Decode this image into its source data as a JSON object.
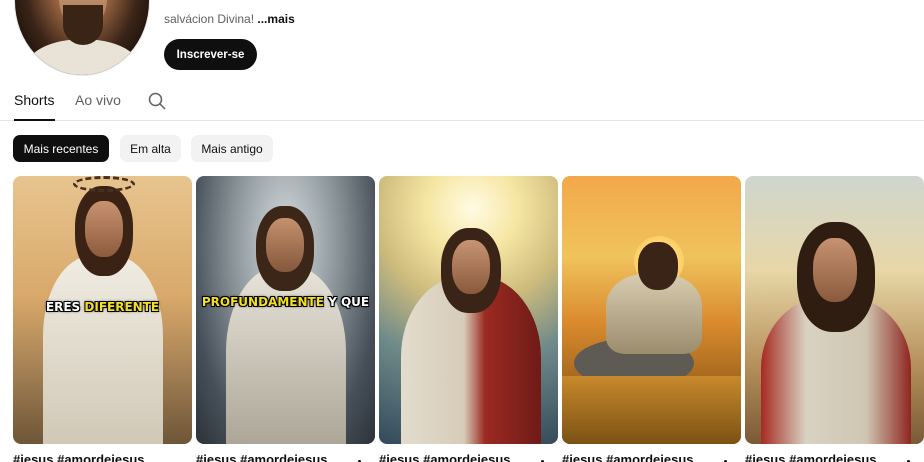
{
  "channel": {
    "description": "salvácion Divina!",
    "more_label": "...mais",
    "subscribe_label": "Inscrever-se"
  },
  "tabs": [
    {
      "label": "Shorts",
      "active": true
    },
    {
      "label": "Ao vivo",
      "active": false
    }
  ],
  "filters": [
    {
      "label": "Mais recentes",
      "active": true
    },
    {
      "label": "Em alta",
      "active": false
    },
    {
      "label": "Mais antigo",
      "active": false
    }
  ],
  "shorts": [
    {
      "title": "#jesus #amordejesus",
      "overlay_plain": "ERES ",
      "overlay_highlight": "DIFERENTE"
    },
    {
      "title": "#jesus #amordejesus",
      "overlay_highlight": "PROFUNDAMENTE",
      "overlay_plain": " Y QUE"
    },
    {
      "title": "#jesus #amordejesus"
    },
    {
      "title": "#jesus #amordejesus"
    },
    {
      "title": "#jesus #amordejesus"
    }
  ],
  "icons": {
    "search": "search-icon",
    "avatar": "channel-avatar",
    "more": "more-vert-icon"
  }
}
